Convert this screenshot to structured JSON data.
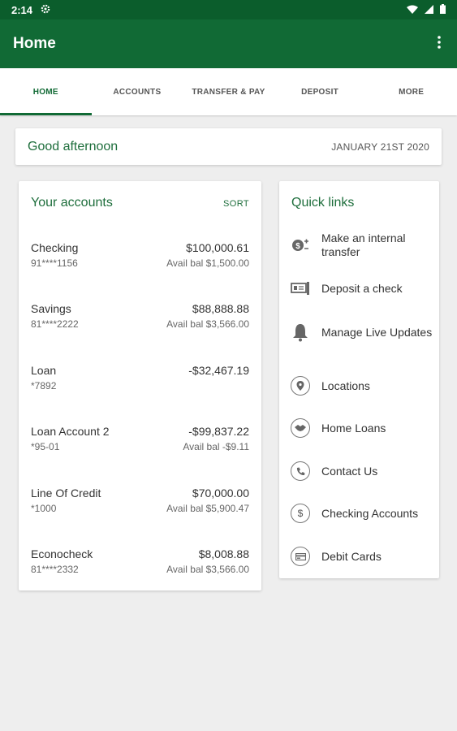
{
  "status": {
    "time": "2:14"
  },
  "appbar": {
    "title": "Home"
  },
  "tabs": [
    {
      "label": "HOME",
      "active": true
    },
    {
      "label": "ACCOUNTS",
      "active": false
    },
    {
      "label": "TRANSFER & PAY",
      "active": false
    },
    {
      "label": "DEPOSIT",
      "active": false
    },
    {
      "label": "MORE",
      "active": false
    }
  ],
  "greeting": {
    "text": "Good afternoon",
    "date": "JANUARY 21ST 2020"
  },
  "accounts": {
    "title": "Your accounts",
    "sort_label": "SORT",
    "items": [
      {
        "name": "Checking",
        "number": "91****1156",
        "amount": "$100,000.61",
        "avail": "Avail bal $1,500.00"
      },
      {
        "name": "Savings",
        "number": "81****2222",
        "amount": "$88,888.88",
        "avail": "Avail bal $3,566.00"
      },
      {
        "name": "Loan",
        "number": "*7892",
        "amount": "-$32,467.19",
        "avail": ""
      },
      {
        "name": "Loan Account 2",
        "number": "*95-01",
        "amount": "-$99,837.22",
        "avail": "Avail bal -$9.11"
      },
      {
        "name": "Line Of Credit",
        "number": "*1000",
        "amount": "$70,000.00",
        "avail": "Avail bal $5,900.47"
      },
      {
        "name": "Econocheck",
        "number": "81****2332",
        "amount": "$8,008.88",
        "avail": "Avail bal $3,566.00"
      }
    ]
  },
  "quick_links": {
    "title": "Quick links",
    "items": [
      {
        "label": "Make an internal transfer",
        "icon": "transfer-icon"
      },
      {
        "label": "Deposit a check",
        "icon": "check-deposit-icon"
      },
      {
        "label": "Manage Live Updates",
        "icon": "bell-icon"
      },
      {
        "label": "Locations",
        "icon": "location-pin-icon"
      },
      {
        "label": "Home Loans",
        "icon": "handshake-icon"
      },
      {
        "label": "Contact Us",
        "icon": "phone-icon"
      },
      {
        "label": "Checking Accounts",
        "icon": "dollar-icon"
      },
      {
        "label": "Debit Cards",
        "icon": "card-icon"
      }
    ]
  },
  "colors": {
    "primary": "#116a35",
    "statusbar": "#0b5d2c",
    "accent_text": "#1e6e3c",
    "background": "#eeeeee"
  }
}
